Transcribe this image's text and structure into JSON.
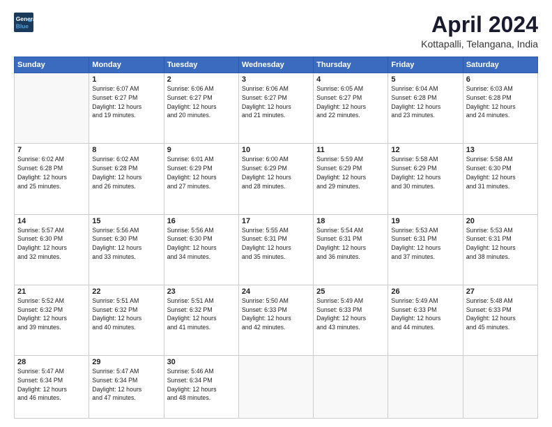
{
  "logo": {
    "line1": "General",
    "line2": "Blue"
  },
  "title": "April 2024",
  "location": "Kottapalli, Telangana, India",
  "headers": [
    "Sunday",
    "Monday",
    "Tuesday",
    "Wednesday",
    "Thursday",
    "Friday",
    "Saturday"
  ],
  "weeks": [
    [
      {
        "day": "",
        "info": ""
      },
      {
        "day": "1",
        "info": "Sunrise: 6:07 AM\nSunset: 6:27 PM\nDaylight: 12 hours\nand 19 minutes."
      },
      {
        "day": "2",
        "info": "Sunrise: 6:06 AM\nSunset: 6:27 PM\nDaylight: 12 hours\nand 20 minutes."
      },
      {
        "day": "3",
        "info": "Sunrise: 6:06 AM\nSunset: 6:27 PM\nDaylight: 12 hours\nand 21 minutes."
      },
      {
        "day": "4",
        "info": "Sunrise: 6:05 AM\nSunset: 6:27 PM\nDaylight: 12 hours\nand 22 minutes."
      },
      {
        "day": "5",
        "info": "Sunrise: 6:04 AM\nSunset: 6:28 PM\nDaylight: 12 hours\nand 23 minutes."
      },
      {
        "day": "6",
        "info": "Sunrise: 6:03 AM\nSunset: 6:28 PM\nDaylight: 12 hours\nand 24 minutes."
      }
    ],
    [
      {
        "day": "7",
        "info": "Sunrise: 6:02 AM\nSunset: 6:28 PM\nDaylight: 12 hours\nand 25 minutes."
      },
      {
        "day": "8",
        "info": "Sunrise: 6:02 AM\nSunset: 6:28 PM\nDaylight: 12 hours\nand 26 minutes."
      },
      {
        "day": "9",
        "info": "Sunrise: 6:01 AM\nSunset: 6:29 PM\nDaylight: 12 hours\nand 27 minutes."
      },
      {
        "day": "10",
        "info": "Sunrise: 6:00 AM\nSunset: 6:29 PM\nDaylight: 12 hours\nand 28 minutes."
      },
      {
        "day": "11",
        "info": "Sunrise: 5:59 AM\nSunset: 6:29 PM\nDaylight: 12 hours\nand 29 minutes."
      },
      {
        "day": "12",
        "info": "Sunrise: 5:58 AM\nSunset: 6:29 PM\nDaylight: 12 hours\nand 30 minutes."
      },
      {
        "day": "13",
        "info": "Sunrise: 5:58 AM\nSunset: 6:30 PM\nDaylight: 12 hours\nand 31 minutes."
      }
    ],
    [
      {
        "day": "14",
        "info": "Sunrise: 5:57 AM\nSunset: 6:30 PM\nDaylight: 12 hours\nand 32 minutes."
      },
      {
        "day": "15",
        "info": "Sunrise: 5:56 AM\nSunset: 6:30 PM\nDaylight: 12 hours\nand 33 minutes."
      },
      {
        "day": "16",
        "info": "Sunrise: 5:56 AM\nSunset: 6:30 PM\nDaylight: 12 hours\nand 34 minutes."
      },
      {
        "day": "17",
        "info": "Sunrise: 5:55 AM\nSunset: 6:31 PM\nDaylight: 12 hours\nand 35 minutes."
      },
      {
        "day": "18",
        "info": "Sunrise: 5:54 AM\nSunset: 6:31 PM\nDaylight: 12 hours\nand 36 minutes."
      },
      {
        "day": "19",
        "info": "Sunrise: 5:53 AM\nSunset: 6:31 PM\nDaylight: 12 hours\nand 37 minutes."
      },
      {
        "day": "20",
        "info": "Sunrise: 5:53 AM\nSunset: 6:31 PM\nDaylight: 12 hours\nand 38 minutes."
      }
    ],
    [
      {
        "day": "21",
        "info": "Sunrise: 5:52 AM\nSunset: 6:32 PM\nDaylight: 12 hours\nand 39 minutes."
      },
      {
        "day": "22",
        "info": "Sunrise: 5:51 AM\nSunset: 6:32 PM\nDaylight: 12 hours\nand 40 minutes."
      },
      {
        "day": "23",
        "info": "Sunrise: 5:51 AM\nSunset: 6:32 PM\nDaylight: 12 hours\nand 41 minutes."
      },
      {
        "day": "24",
        "info": "Sunrise: 5:50 AM\nSunset: 6:33 PM\nDaylight: 12 hours\nand 42 minutes."
      },
      {
        "day": "25",
        "info": "Sunrise: 5:49 AM\nSunset: 6:33 PM\nDaylight: 12 hours\nand 43 minutes."
      },
      {
        "day": "26",
        "info": "Sunrise: 5:49 AM\nSunset: 6:33 PM\nDaylight: 12 hours\nand 44 minutes."
      },
      {
        "day": "27",
        "info": "Sunrise: 5:48 AM\nSunset: 6:33 PM\nDaylight: 12 hours\nand 45 minutes."
      }
    ],
    [
      {
        "day": "28",
        "info": "Sunrise: 5:47 AM\nSunset: 6:34 PM\nDaylight: 12 hours\nand 46 minutes."
      },
      {
        "day": "29",
        "info": "Sunrise: 5:47 AM\nSunset: 6:34 PM\nDaylight: 12 hours\nand 47 minutes."
      },
      {
        "day": "30",
        "info": "Sunrise: 5:46 AM\nSunset: 6:34 PM\nDaylight: 12 hours\nand 48 minutes."
      },
      {
        "day": "",
        "info": ""
      },
      {
        "day": "",
        "info": ""
      },
      {
        "day": "",
        "info": ""
      },
      {
        "day": "",
        "info": ""
      }
    ]
  ]
}
